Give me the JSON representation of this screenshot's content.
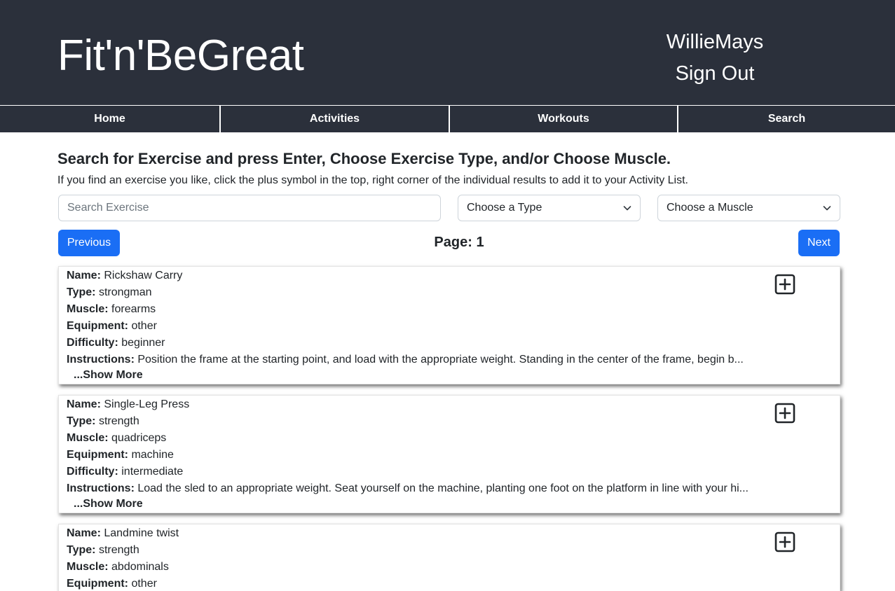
{
  "header": {
    "brand": "Fit'n'BeGreat",
    "username": "WillieMays",
    "signout_label": "Sign Out"
  },
  "nav": {
    "items": [
      {
        "label": "Home"
      },
      {
        "label": "Activities"
      },
      {
        "label": "Workouts"
      },
      {
        "label": "Search"
      }
    ]
  },
  "search": {
    "heading": "Search for Exercise and press Enter, Choose Exercise Type, and/or Choose Muscle.",
    "subtext": "If you find an exercise you like, click the plus symbol in the top, right corner of the individual results to add it to your Activity List.",
    "input_placeholder": "Search Exercise",
    "type_select": "Choose a Type",
    "muscle_select": "Choose a Muscle"
  },
  "pagination": {
    "previous_label": "Previous",
    "page_label": "Page: 1",
    "next_label": "Next"
  },
  "labels": {
    "name": "Name:",
    "type": "Type:",
    "muscle": "Muscle:",
    "equipment": "Equipment:",
    "difficulty": "Difficulty:",
    "instructions": "Instructions:",
    "show_more": "...Show More"
  },
  "results": [
    {
      "name": "Rickshaw Carry",
      "type": "strongman",
      "muscle": "forearms",
      "equipment": "other",
      "difficulty": "beginner",
      "instructions": "Position the frame at the starting point, and load with the appropriate weight. Standing in the center of the frame, begin b..."
    },
    {
      "name": "Single-Leg Press",
      "type": "strength",
      "muscle": "quadriceps",
      "equipment": "machine",
      "difficulty": "intermediate",
      "instructions": "Load the sled to an appropriate weight. Seat yourself on the machine, planting one foot on the platform in line with your hi..."
    },
    {
      "name": "Landmine twist",
      "type": "strength",
      "muscle": "abdominals",
      "equipment": "other"
    }
  ]
}
